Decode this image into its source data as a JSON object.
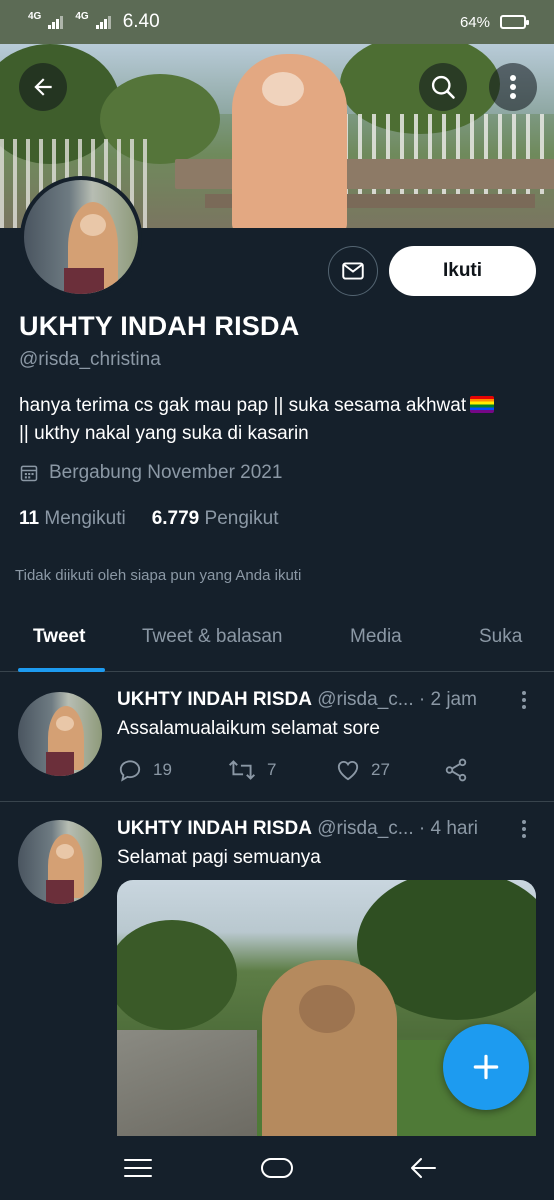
{
  "status_bar": {
    "signal1": "4G",
    "signal2": "4G",
    "time": "6.40",
    "battery_percent_label": "64%",
    "battery_level": 0.64
  },
  "header": {
    "back_icon": "arrow-left-icon",
    "search_icon": "search-icon",
    "more_icon": "more-vertical-icon"
  },
  "profile": {
    "name": "UKHTY INDAH RISDA",
    "handle": "@risda_christina",
    "bio_line1": "hanya terima cs gak mau pap || suka sesama akhwat",
    "bio_line2": "|| ukthy nakal yang suka di kasarin",
    "joined": "Bergabung November 2021",
    "following_count": "11",
    "following_label": "Mengikuti",
    "followers_count": "6.779",
    "followers_label": "Pengikut",
    "not_followed_text": "Tidak diikuti oleh siapa pun yang Anda ikuti",
    "follow_button": "Ikuti",
    "message_icon": "mail-icon"
  },
  "tabs": [
    {
      "label": "Tweet",
      "active": true
    },
    {
      "label": "Tweet & balasan",
      "active": false
    },
    {
      "label": "Media",
      "active": false
    },
    {
      "label": "Suka",
      "active": false
    }
  ],
  "tweets": [
    {
      "name": "UKHTY INDAH RISDA",
      "handle": "@risda_c...",
      "dot": "·",
      "time": "2 jam",
      "text": "Assalamualaikum selamat sore",
      "replies": "19",
      "retweets": "7",
      "likes": "27"
    },
    {
      "name": "UKHTY INDAH RISDA",
      "handle": "@risda_c...",
      "dot": "·",
      "time": "4 hari",
      "text": "Selamat pagi semuanya"
    }
  ],
  "colors": {
    "background": "#15202b",
    "accent": "#1d9bf0",
    "muted_text": "#8b98a5",
    "divider": "#38444d"
  },
  "fab_icon": "plus-icon",
  "nav": {
    "menu_icon": "menu-icon",
    "home_icon": "home-pill-icon",
    "back_icon": "back-triangle-icon"
  }
}
